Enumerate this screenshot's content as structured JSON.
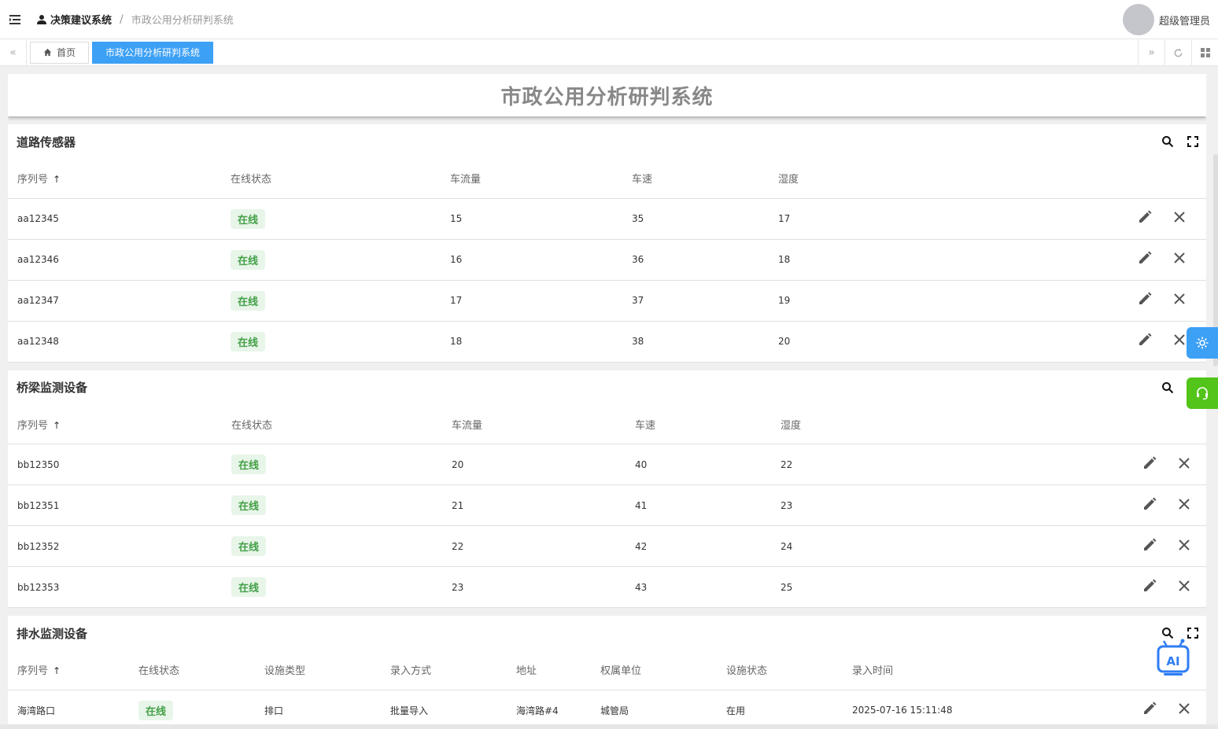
{
  "header": {
    "breadcrumb_root": "决策建议系统",
    "breadcrumb_sep": "/",
    "breadcrumb_current": "市政公用分析研判系统",
    "user_name": "超级管理员"
  },
  "tabs": [
    {
      "label": "首页",
      "icon": "home-icon"
    },
    {
      "label": "市政公用分析研判系统",
      "active": true
    }
  ],
  "page_title": "市政公用分析研判系统",
  "colors": {
    "accent": "#3ca0f5",
    "online_badge": "#43a047",
    "support": "#52c41a"
  },
  "road_sensors": {
    "title": "道路传感器",
    "columns": [
      "序列号",
      "在线状态",
      "车流量",
      "车速",
      "湿度"
    ],
    "rows": [
      {
        "serial": "aa12345",
        "status": "在线",
        "flow": "15",
        "speed": "35",
        "humidity": "17"
      },
      {
        "serial": "aa12346",
        "status": "在线",
        "flow": "16",
        "speed": "36",
        "humidity": "18"
      },
      {
        "serial": "aa12347",
        "status": "在线",
        "flow": "17",
        "speed": "37",
        "humidity": "19"
      },
      {
        "serial": "aa12348",
        "status": "在线",
        "flow": "18",
        "speed": "38",
        "humidity": "20"
      }
    ]
  },
  "bridge_devices": {
    "title": "桥梁监测设备",
    "columns": [
      "序列号",
      "在线状态",
      "车流量",
      "车速",
      "湿度"
    ],
    "rows": [
      {
        "serial": "bb12350",
        "status": "在线",
        "flow": "20",
        "speed": "40",
        "humidity": "22"
      },
      {
        "serial": "bb12351",
        "status": "在线",
        "flow": "21",
        "speed": "41",
        "humidity": "23"
      },
      {
        "serial": "bb12352",
        "status": "在线",
        "flow": "22",
        "speed": "42",
        "humidity": "24"
      },
      {
        "serial": "bb12353",
        "status": "在线",
        "flow": "23",
        "speed": "43",
        "humidity": "25"
      }
    ]
  },
  "drainage_devices": {
    "title": "排水监测设备",
    "columns": [
      "序列号",
      "在线状态",
      "设施类型",
      "录入方式",
      "地址",
      "权属单位",
      "设施状态",
      "录入时间"
    ],
    "rows": [
      {
        "serial": "海湾路口",
        "status": "在线",
        "type": "排口",
        "entry": "批量导入",
        "address": "海湾路#4",
        "owner": "城管局",
        "facility_status": "在用",
        "time": "2025-07-16 15:11:48"
      }
    ]
  }
}
